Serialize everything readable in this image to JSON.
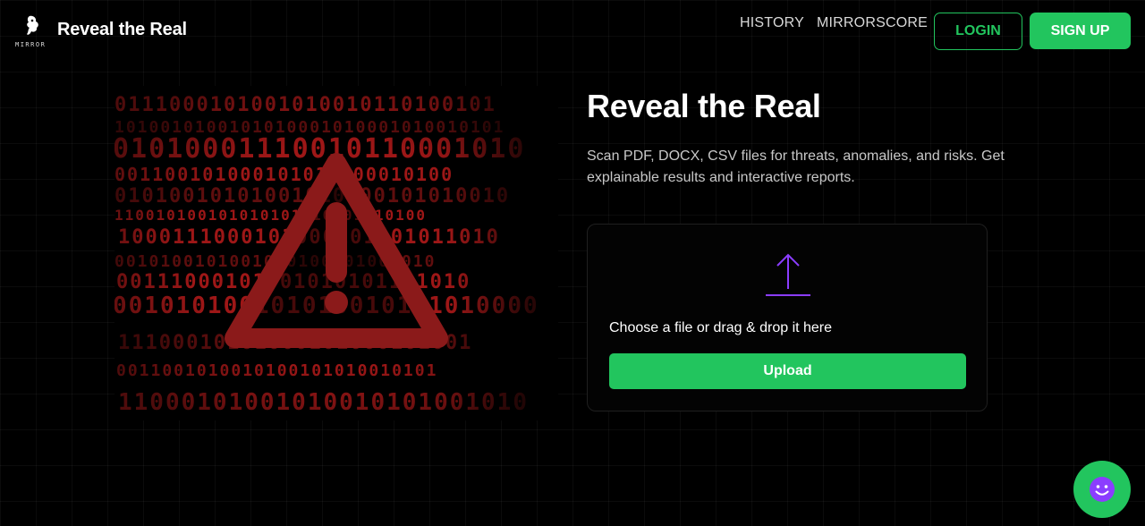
{
  "brand": {
    "logo_word": "MIRROR",
    "title": "Reveal the Real"
  },
  "nav": {
    "history": "HISTORY",
    "mirrorscore": "MIRRORSCORE",
    "login": "LOGIN",
    "signup": "SIGN UP"
  },
  "hero": {
    "title": "Reveal the Real",
    "description": "Scan PDF, DOCX, CSV files for threats, anomalies, and risks. Get explainable results and interactive reports.",
    "binary_lines": [
      "0111000101001010010110100101",
      "1010010100101010001010001010010101",
      "01010001110010110001010",
      "001100101000101011100010100",
      "01010010101001010100101010010",
      "110010100101010101010001010100",
      "1000111000101000101001011010",
      "0010100101001000100101001010",
      "00111000101001010101101010",
      "001010100101010010101010000",
      "11100010101000101000101001",
      "0011001010010100101010010101",
      "11000101001010010101001010"
    ]
  },
  "upload": {
    "prompt": "Choose a file or drag & drop it here",
    "button": "Upload"
  },
  "icons": {
    "logo": "mirror-logo-icon",
    "upload": "upload-arrow-icon",
    "chat": "smiley-chat-icon",
    "warning": "warning-triangle-icon"
  },
  "colors": {
    "accent_green": "#22c55e",
    "upload_icon_purple": "#8b3dff",
    "warning_red": "#8b1a1a",
    "binary_red": "#b01a1a"
  }
}
